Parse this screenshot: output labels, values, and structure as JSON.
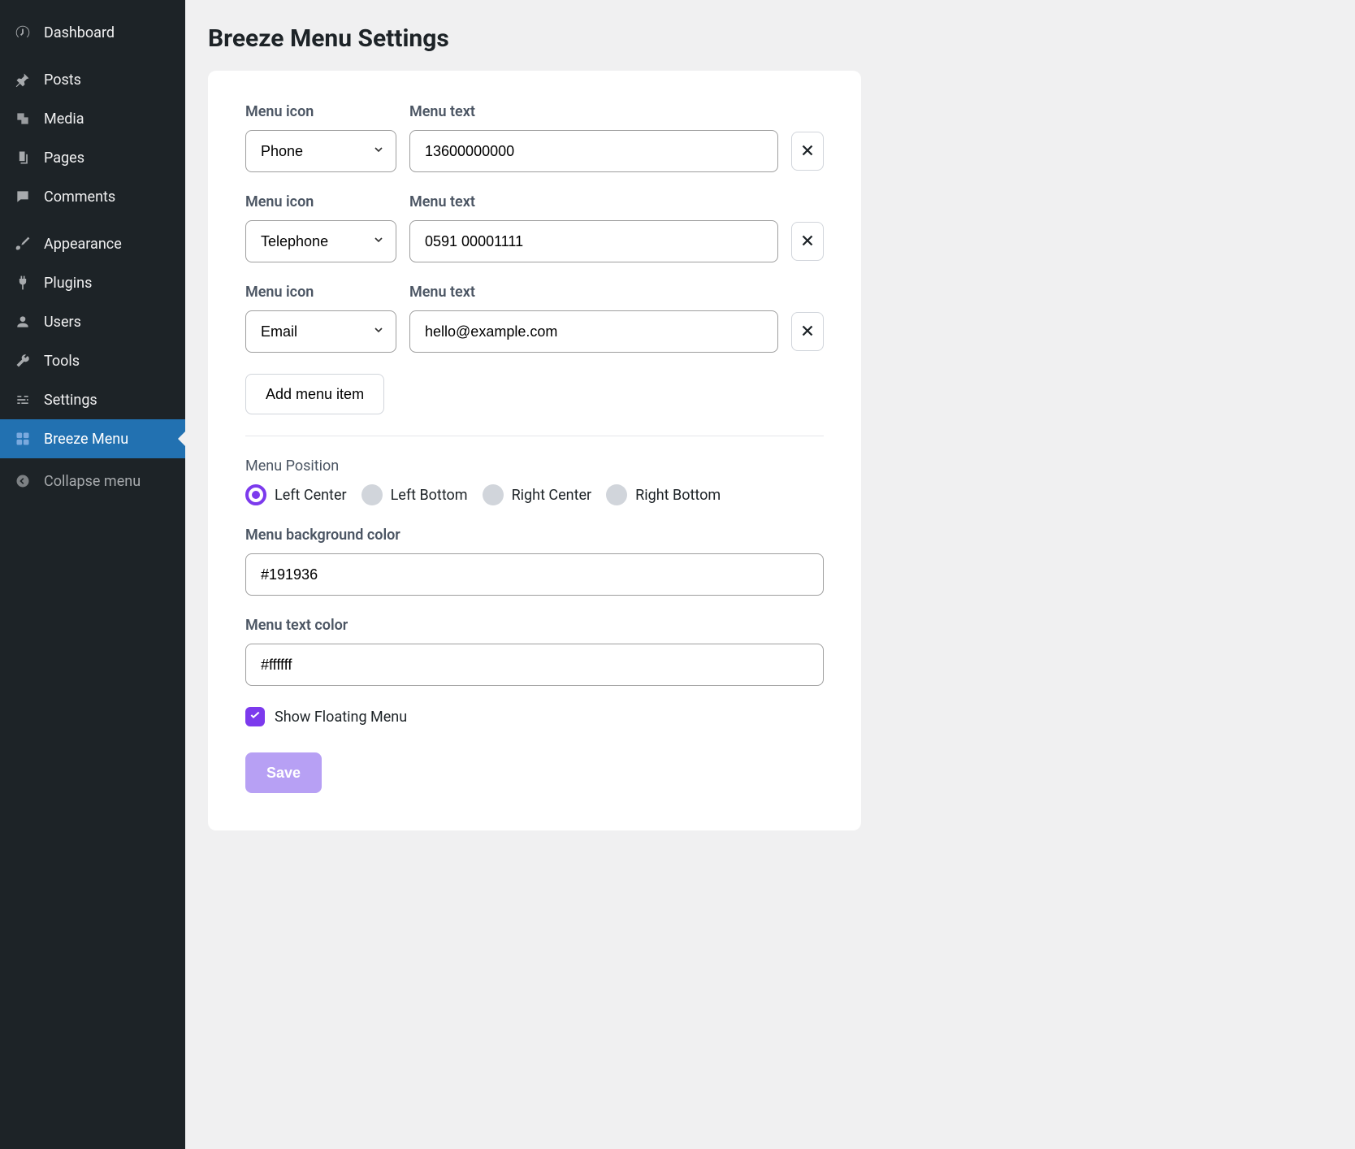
{
  "sidebar": {
    "items": [
      {
        "label": "Dashboard",
        "icon": "dashboard"
      },
      {
        "label": "Posts",
        "icon": "pin"
      },
      {
        "label": "Media",
        "icon": "media"
      },
      {
        "label": "Pages",
        "icon": "pages"
      },
      {
        "label": "Comments",
        "icon": "comment"
      },
      {
        "label": "Appearance",
        "icon": "brush"
      },
      {
        "label": "Plugins",
        "icon": "plug"
      },
      {
        "label": "Users",
        "icon": "user"
      },
      {
        "label": "Tools",
        "icon": "wrench"
      },
      {
        "label": "Settings",
        "icon": "sliders"
      },
      {
        "label": "Breeze Menu",
        "icon": "grid",
        "active": true
      }
    ],
    "collapse_label": "Collapse menu"
  },
  "page": {
    "title": "Breeze Menu Settings"
  },
  "labels": {
    "menu_icon": "Menu icon",
    "menu_text": "Menu text",
    "add_item": "Add menu item",
    "menu_position": "Menu Position",
    "bg_color": "Menu background color",
    "text_color": "Menu text color",
    "show_floating": "Show Floating Menu",
    "save": "Save"
  },
  "menu_items": [
    {
      "icon": "Phone",
      "text": "13600000000"
    },
    {
      "icon": "Telephone",
      "text": "0591 00001111"
    },
    {
      "icon": "Email",
      "text": "hello@example.com"
    }
  ],
  "position_options": [
    {
      "label": "Left Center",
      "checked": true
    },
    {
      "label": "Left Bottom",
      "checked": false
    },
    {
      "label": "Right Center",
      "checked": false
    },
    {
      "label": "Right Bottom",
      "checked": false
    }
  ],
  "colors": {
    "bg": "#191936",
    "text": "#ffffff"
  },
  "show_floating": true,
  "icon_options": [
    "Phone",
    "Telephone",
    "Email"
  ]
}
